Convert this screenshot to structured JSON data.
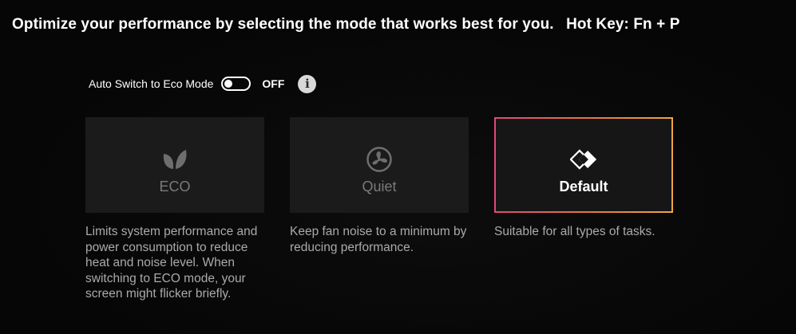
{
  "header": {
    "text": "Optimize your performance by selecting the mode that works best for you.",
    "hotkey": "Hot Key: Fn + P"
  },
  "auto_switch": {
    "label": "Auto Switch to Eco Mode",
    "state": "OFF",
    "enabled": false,
    "info_icon": "info-icon"
  },
  "modes": [
    {
      "title": "ECO",
      "icon": "leaf-icon",
      "selected": false,
      "description": "Limits system performance and power consumption to reduce heat and noise level. When switching to ECO mode, your screen might flicker briefly."
    },
    {
      "title": "Quiet",
      "icon": "fan-icon",
      "selected": false,
      "description": "Keep fan noise to a minimum by reducing performance."
    },
    {
      "title": "Default",
      "icon": "diamond-icon",
      "selected": true,
      "description": "Suitable for all types of tasks."
    }
  ],
  "colors": {
    "background": "#070707",
    "card": "#1b1b1b",
    "selected_border_start": "#e0487a",
    "selected_border_end": "#f0a540",
    "muted_text": "#aaaaaa"
  }
}
